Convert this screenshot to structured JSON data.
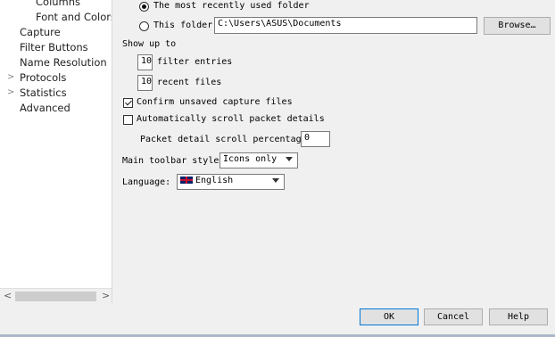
{
  "sidebar": {
    "items": [
      {
        "label": "Columns"
      },
      {
        "label": "Font and Colors"
      },
      {
        "label": "Capture"
      },
      {
        "label": "Filter Buttons"
      },
      {
        "label": "Name Resolution"
      },
      {
        "label": "Protocols"
      },
      {
        "label": "Statistics"
      },
      {
        "label": "Advanced"
      }
    ]
  },
  "folder": {
    "recent_label": "The most recently used folder",
    "this_folder_label": "This folder:",
    "path": "C:\\Users\\ASUS\\Documents",
    "browse_label": "Browse…"
  },
  "show_up_to": {
    "heading": "Show up to",
    "filter_count": "10",
    "filter_label": "filter entries",
    "recent_count": "10",
    "recent_label": "recent files"
  },
  "options": {
    "confirm_unsaved": "Confirm unsaved capture files",
    "auto_scroll": "Automatically scroll packet details",
    "scroll_pct_label": "Packet detail scroll percentage:",
    "scroll_pct_value": "0"
  },
  "toolbar_style": {
    "label": "Main toolbar style:",
    "value": "Icons only"
  },
  "language": {
    "label": "Language:",
    "value": "English"
  },
  "buttons": {
    "ok": "OK",
    "cancel": "Cancel",
    "help": "Help"
  },
  "scrollbar": {
    "left_arrow": "<",
    "right_arrow": ">"
  },
  "tree": {
    "expand_glyph": ">"
  }
}
